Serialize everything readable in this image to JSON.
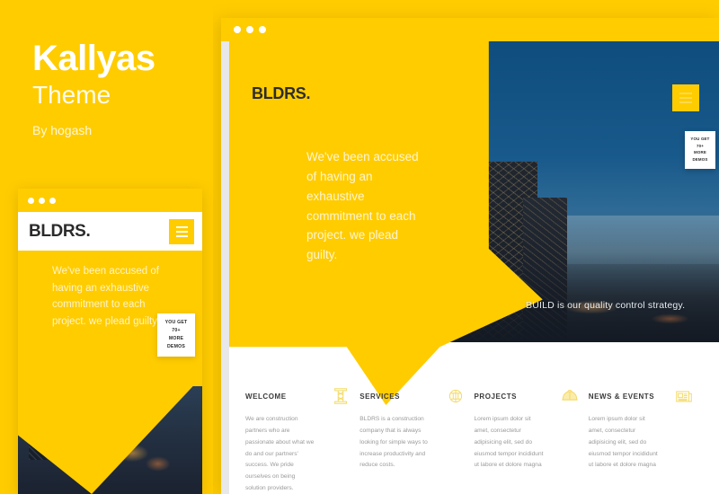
{
  "promo": {
    "title": "Kallyas",
    "subtitle": "Theme",
    "author": "By hogash"
  },
  "colors": {
    "accent_yellow": "#FFCC00",
    "sky_blue": "#18598B",
    "dark_text": "#2D2D2D",
    "body_text": "#9A9A9A"
  },
  "badge": {
    "line1": "YOU GET",
    "line2": "70+",
    "line3": "MORE",
    "line4": "DEMOS"
  },
  "mobile_preview": {
    "logo": "BLDRS.",
    "headline": "We've been accused of having an exhaustive commitment to each project. we plead guilty.",
    "menu_icon": "hamburger-icon"
  },
  "browser": {
    "logo": "BLDRS.",
    "headline": "We've been accused of having an exhaustive commitment to each project. we plead guilty.",
    "tagline": "BUILD is our quality control strategy.",
    "menu_icon": "hamburger-icon",
    "features": [
      {
        "title": "WELCOME",
        "icon": "pillar-icon",
        "body": "We are construction partners who are passionate about what we do and our partners' success. We pride ourselves on being solution providers."
      },
      {
        "title": "SERVICES",
        "icon": "crane-icon",
        "body": "BLDRS is a construction company that is always looking for simple ways to increase productivity and reduce costs."
      },
      {
        "title": "PROJECTS",
        "icon": "helmet-icon",
        "body": "Lorem ipsum dolor sit amet, consectetur adipisicing elit, sed do eiusmod tempor incididunt ut labore et dolore magna"
      },
      {
        "title": "NEWS & EVENTS",
        "icon": "newspaper-icon",
        "body": "Lorem ipsum dolor sit amet, consectetur adipisicing elit, sed do eiusmod tempor incididunt ut labore et dolore magna"
      }
    ]
  }
}
